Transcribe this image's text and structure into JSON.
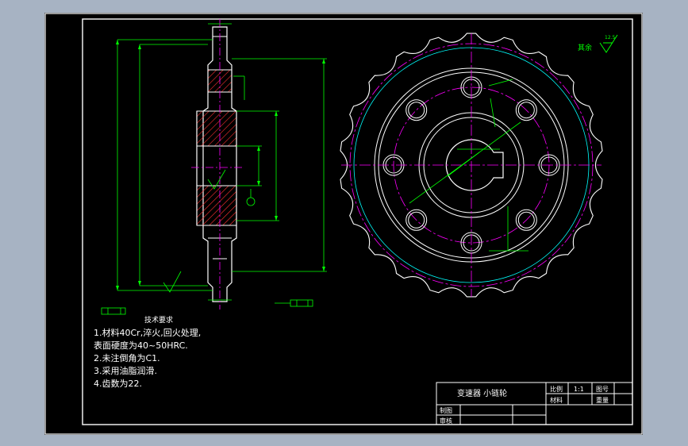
{
  "drawing": {
    "title": "变速器 小链轮",
    "roughness_label": "其余",
    "roughness_value": "12.5"
  },
  "notes": {
    "heading": "技术要求",
    "lines": [
      "1.材料40Cr,淬火,回火处理,",
      "表面硬度为40~50HRC.",
      "2.未注倒角为C1.",
      "3.采用油脂润滑.",
      "4.齿数为22."
    ]
  },
  "title_block": {
    "scale_label": "比例",
    "scale_value": "1:1",
    "sheet_label": "图号",
    "material_label": "材料",
    "weight_label": "重量",
    "draw_label": "制图",
    "check_label": "审核"
  },
  "colors": {
    "background": "#000000",
    "outline": "#ffffff",
    "dimension": "#00ff00",
    "centerline": "#ff00ff",
    "pitch": "#00ffff",
    "hatch": "#ff3030"
  }
}
